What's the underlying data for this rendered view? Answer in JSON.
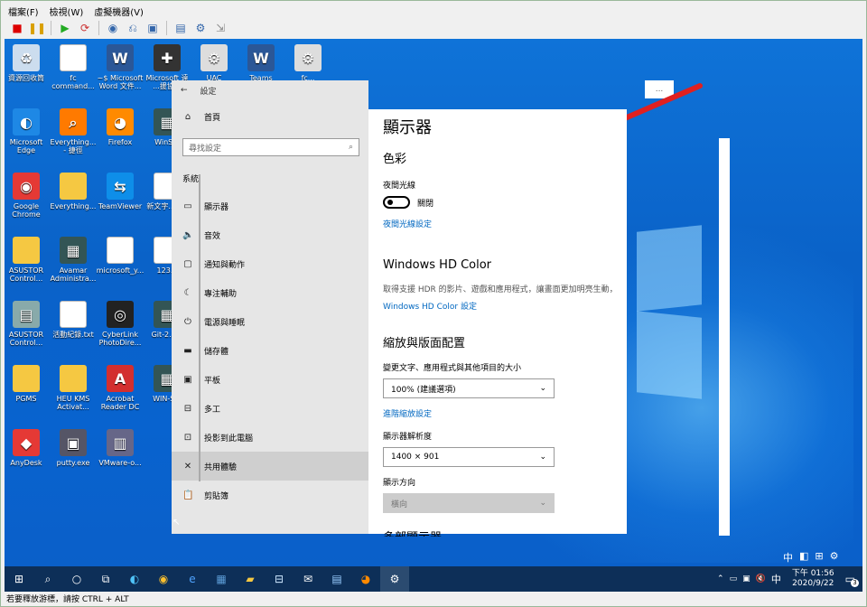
{
  "menubar": {
    "file": "檔案(F)",
    "view": "檢視(W)",
    "vm": "虛擬機器(V)"
  },
  "toolbar": {
    "icons": [
      "stop-icon",
      "pause-icon",
      "play-icon",
      "refresh-icon",
      "snapshot-icon",
      "revert-icon",
      "screen-icon",
      "save-icon",
      "settings-icon",
      "usb-icon"
    ]
  },
  "desktop": {
    "icons": [
      {
        "label": "資源回收筒",
        "icon": "recycle-bin-icon"
      },
      {
        "label": "fc command...",
        "icon": "file-icon"
      },
      {
        "label": "~$ Microsoft Word 文件...",
        "icon": "word-icon"
      },
      {
        "label": "Microsoft 遠 ...援協助",
        "icon": "tool-icon"
      },
      {
        "label": "UAC Teamviewer...",
        "icon": "gear-icon"
      },
      {
        "label": "Teams Direct...",
        "icon": "word-icon"
      },
      {
        "label": "fc...",
        "icon": "gear-icon"
      },
      {
        "label": "Microsoft Edge",
        "icon": "edge-icon"
      },
      {
        "label": "Everything... - 捷徑",
        "icon": "search-icon"
      },
      {
        "label": "Firefox",
        "icon": "firefox-icon"
      },
      {
        "label": "WinS...",
        "icon": "app-icon"
      },
      {
        "label": "Google Chrome",
        "icon": "chrome-icon"
      },
      {
        "label": "Everything...",
        "icon": "folder-icon"
      },
      {
        "label": "TeamViewer",
        "icon": "teamviewer-icon"
      },
      {
        "label": "新文字... txt",
        "icon": "file-icon"
      },
      {
        "label": "ASUSTOR Control...",
        "icon": "folder-icon"
      },
      {
        "label": "Avamar Administra...",
        "icon": "app-icon"
      },
      {
        "label": "microsoft_y...",
        "icon": "file-icon"
      },
      {
        "label": "123...",
        "icon": "file-icon"
      },
      {
        "label": "ASUSTOR Control...",
        "icon": "asustor-icon"
      },
      {
        "label": "活動紀錄.txt",
        "icon": "file-icon"
      },
      {
        "label": "CyberLink PhotoDire...",
        "icon": "cyberlink-icon"
      },
      {
        "label": "Git-2.2...",
        "icon": "app-icon"
      },
      {
        "label": "PGMS",
        "icon": "folder-icon"
      },
      {
        "label": "HEU KMS Activat...",
        "icon": "folder-icon"
      },
      {
        "label": "Acrobat Reader DC",
        "icon": "acrobat-icon"
      },
      {
        "label": "WIN-S...",
        "icon": "app-icon"
      },
      {
        "label": "AnyDesk",
        "icon": "anydesk-icon"
      },
      {
        "label": "putty.exe",
        "icon": "putty-icon"
      },
      {
        "label": "VMware-o...",
        "icon": "vmware-icon"
      }
    ]
  },
  "settings": {
    "back": "←",
    "title": "設定",
    "home": "首頁",
    "search_placeholder": "尋找設定",
    "section": "系統",
    "nav": [
      {
        "label": "顯示器",
        "icon": "monitor-icon",
        "glyph": "▭"
      },
      {
        "label": "音效",
        "icon": "speaker-icon",
        "glyph": "🔈"
      },
      {
        "label": "通知與動作",
        "icon": "notification-icon",
        "glyph": "▢"
      },
      {
        "label": "專注輔助",
        "icon": "moon-icon",
        "glyph": "☾"
      },
      {
        "label": "電源與睡眠",
        "icon": "power-icon",
        "glyph": "⏻"
      },
      {
        "label": "儲存體",
        "icon": "storage-icon",
        "glyph": "▬"
      },
      {
        "label": "平板",
        "icon": "tablet-icon",
        "glyph": "▣"
      },
      {
        "label": "多工",
        "icon": "multitask-icon",
        "glyph": "⊟"
      },
      {
        "label": "投影到此電腦",
        "icon": "project-icon",
        "glyph": "⊡"
      },
      {
        "label": "共用體驗",
        "icon": "shared-icon",
        "glyph": "✕"
      },
      {
        "label": "剪貼簿",
        "icon": "clipboard-icon",
        "glyph": "📋"
      }
    ]
  },
  "display": {
    "title": "顯示器",
    "color_h": "色彩",
    "night_light": "夜間光線",
    "toggle_state": "關閉",
    "night_settings": "夜間光線設定",
    "hdr_h": "Windows HD Color",
    "hdr_desc": "取得支援 HDR 的影片、遊戲和應用程式，讓畫面更加明亮生動，",
    "hdr_link": "Windows HD Color 設定",
    "scale_h": "縮放與版面配置",
    "scale_label": "變更文字、應用程式與其他項目的大小",
    "scale_value": "100% (建議選項)",
    "adv_scale": "進階縮放設定",
    "res_label": "顯示器解析度",
    "res_value": "1400 × 901",
    "orient_label": "顯示方向",
    "orient_value": "橫向",
    "more": "多部顯示器"
  },
  "small_window": "...",
  "ime": {
    "lang": "中"
  },
  "tray": {
    "lang": "中",
    "time": "下午 01:56",
    "date": "2020/9/22",
    "badge": "3"
  },
  "status": "若要釋放游標，請按 CTRL + ALT",
  "colors": {
    "arrow": "#e02020",
    "desktop": "#0a64cc",
    "taskbar": "#0d2f58",
    "link": "#0067c0"
  }
}
